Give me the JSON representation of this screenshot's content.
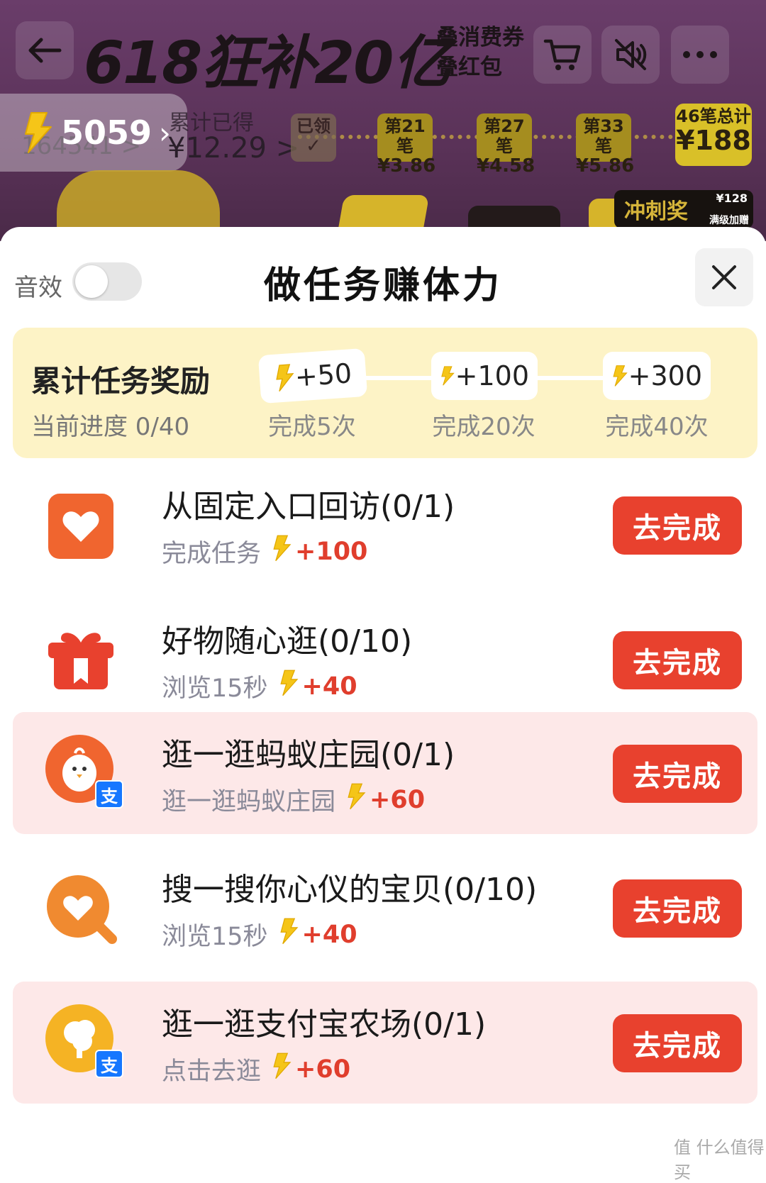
{
  "banner": {
    "title": "618狂补20亿",
    "subtitle_1": "叠消费券",
    "subtitle_2": "叠红包",
    "energy_value": "5059",
    "earned_label": "累计已得",
    "earned_amount": "¥12.29 >",
    "ghost_number": "164541 >",
    "steps": [
      {
        "label": "已领",
        "value": "✓",
        "state": "done"
      },
      {
        "label": "第21笔",
        "value": "¥3.86",
        "state": "pending"
      },
      {
        "label": "第27笔",
        "value": "¥4.58",
        "state": "pending"
      },
      {
        "label": "第33笔",
        "value": "¥5.86",
        "state": "pending"
      },
      {
        "label": "46笔总计",
        "value": "¥188",
        "state": "total"
      }
    ],
    "sprint_label": "冲刺奖",
    "sprint_badge": "¥128",
    "sprint_note": "满级加赠"
  },
  "sheet": {
    "sound_label": "音效",
    "sound_on": false,
    "title": "做任务赚体力",
    "close_icon": "close-icon"
  },
  "reward_panel": {
    "title": "累计任务奖励",
    "progress": "当前进度 0/40",
    "milestones": [
      {
        "reward": "+50",
        "label": "完成5次"
      },
      {
        "reward": "+100",
        "label": "完成20次"
      },
      {
        "reward": "+300",
        "label": "完成40次"
      }
    ]
  },
  "tasks": [
    {
      "icon": "heart-app-icon",
      "title": "从固定入口回访(0/1)",
      "desc": "完成任务",
      "reward": "+100",
      "button": "去完成",
      "highlight": false
    },
    {
      "icon": "gift-icon",
      "title": "好物随心逛(0/10)",
      "desc": "浏览15秒",
      "reward": "+40",
      "button": "去完成",
      "highlight": false
    },
    {
      "icon": "ant-farm-chick-icon",
      "title": "逛一逛蚂蚁庄园(0/1)",
      "desc": "逛一逛蚂蚁庄园",
      "reward": "+60",
      "button": "去完成",
      "highlight": true
    },
    {
      "icon": "heart-search-icon",
      "title": "搜一搜你心仪的宝贝(0/10)",
      "desc": "浏览15秒",
      "reward": "+40",
      "button": "去完成",
      "highlight": false
    },
    {
      "icon": "alipay-farm-tree-icon",
      "title": "逛一逛支付宝农场(0/1)",
      "desc": "点击去逛",
      "reward": "+60",
      "button": "去完成",
      "highlight": true
    }
  ],
  "alipay_badge": "支",
  "watermark": "值 什么值得买",
  "colors": {
    "accent_red": "#e8412e",
    "reward_red": "#e03e2d",
    "energy_yellow": "#f5c518",
    "panel_yellow": "#fdf3c6",
    "highlight_pink": "#fde8e8"
  }
}
